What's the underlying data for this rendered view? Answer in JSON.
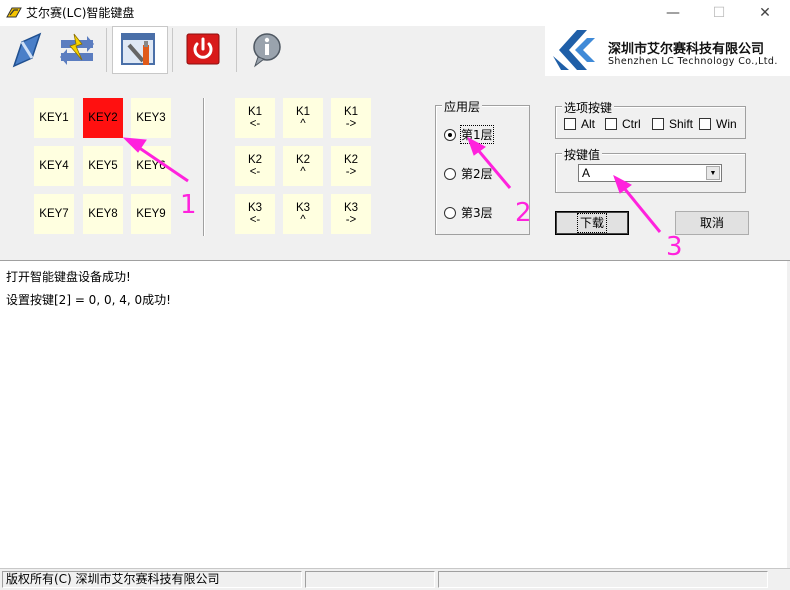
{
  "window": {
    "title": "艾尔赛(LC)智能键盘",
    "minimize": "—",
    "maximize": "☐",
    "close": "✕"
  },
  "toolbar": {
    "buttons": [
      {
        "icon": "connect-icon"
      },
      {
        "icon": "switch-icon"
      },
      {
        "icon": "settings-tools-icon",
        "selected": true
      },
      {
        "icon": "power-icon"
      },
      {
        "icon": "info-icon"
      }
    ]
  },
  "logo": {
    "cn": "深圳市艾尔赛科技有限公司",
    "en": "Shenzhen LC Technology Co.,Ltd."
  },
  "keys": [
    {
      "label": "KEY1",
      "active": false
    },
    {
      "label": "KEY2",
      "active": true
    },
    {
      "label": "KEY3",
      "active": false
    },
    {
      "label": "KEY4",
      "active": false
    },
    {
      "label": "KEY5",
      "active": false
    },
    {
      "label": "KEY6",
      "active": false
    },
    {
      "label": "KEY7",
      "active": false
    },
    {
      "label": "KEY8",
      "active": false
    },
    {
      "label": "KEY9",
      "active": false
    }
  ],
  "knobs": [
    {
      "top": "K1",
      "bottom": "<-"
    },
    {
      "top": "K1",
      "bottom": "^"
    },
    {
      "top": "K1",
      "bottom": "->"
    },
    {
      "top": "K2",
      "bottom": "<-"
    },
    {
      "top": "K2",
      "bottom": "^"
    },
    {
      "top": "K2",
      "bottom": "->"
    },
    {
      "top": "K3",
      "bottom": "<-"
    },
    {
      "top": "K3",
      "bottom": "^"
    },
    {
      "top": "K3",
      "bottom": "->"
    }
  ],
  "layer_group": {
    "title": "应用层",
    "options": [
      {
        "label": "第1层",
        "selected": true
      },
      {
        "label": "第2层",
        "selected": false
      },
      {
        "label": "第3层",
        "selected": false
      }
    ]
  },
  "modifier_group": {
    "title": "选项按键",
    "options": [
      {
        "label": "Alt",
        "checked": false
      },
      {
        "label": "Ctrl",
        "checked": false
      },
      {
        "label": "Shift",
        "checked": false
      },
      {
        "label": "Win",
        "checked": false
      }
    ]
  },
  "keyvalue_group": {
    "title": "按键值",
    "selected": "A"
  },
  "buttons": {
    "download": "下载",
    "cancel": "取消"
  },
  "annotations": [
    "1",
    "2",
    "3"
  ],
  "annotation_color": "#ff22dd",
  "active_key_color": "#ff1010",
  "key_bg_color": "#ffffe0",
  "log": [
    "打开智能键盘设备成功!",
    "设置按键[2] = 0,  0,  4, 0成功!"
  ],
  "status": {
    "copyright": "版权所有(C) 深圳市艾尔赛科技有限公司"
  }
}
